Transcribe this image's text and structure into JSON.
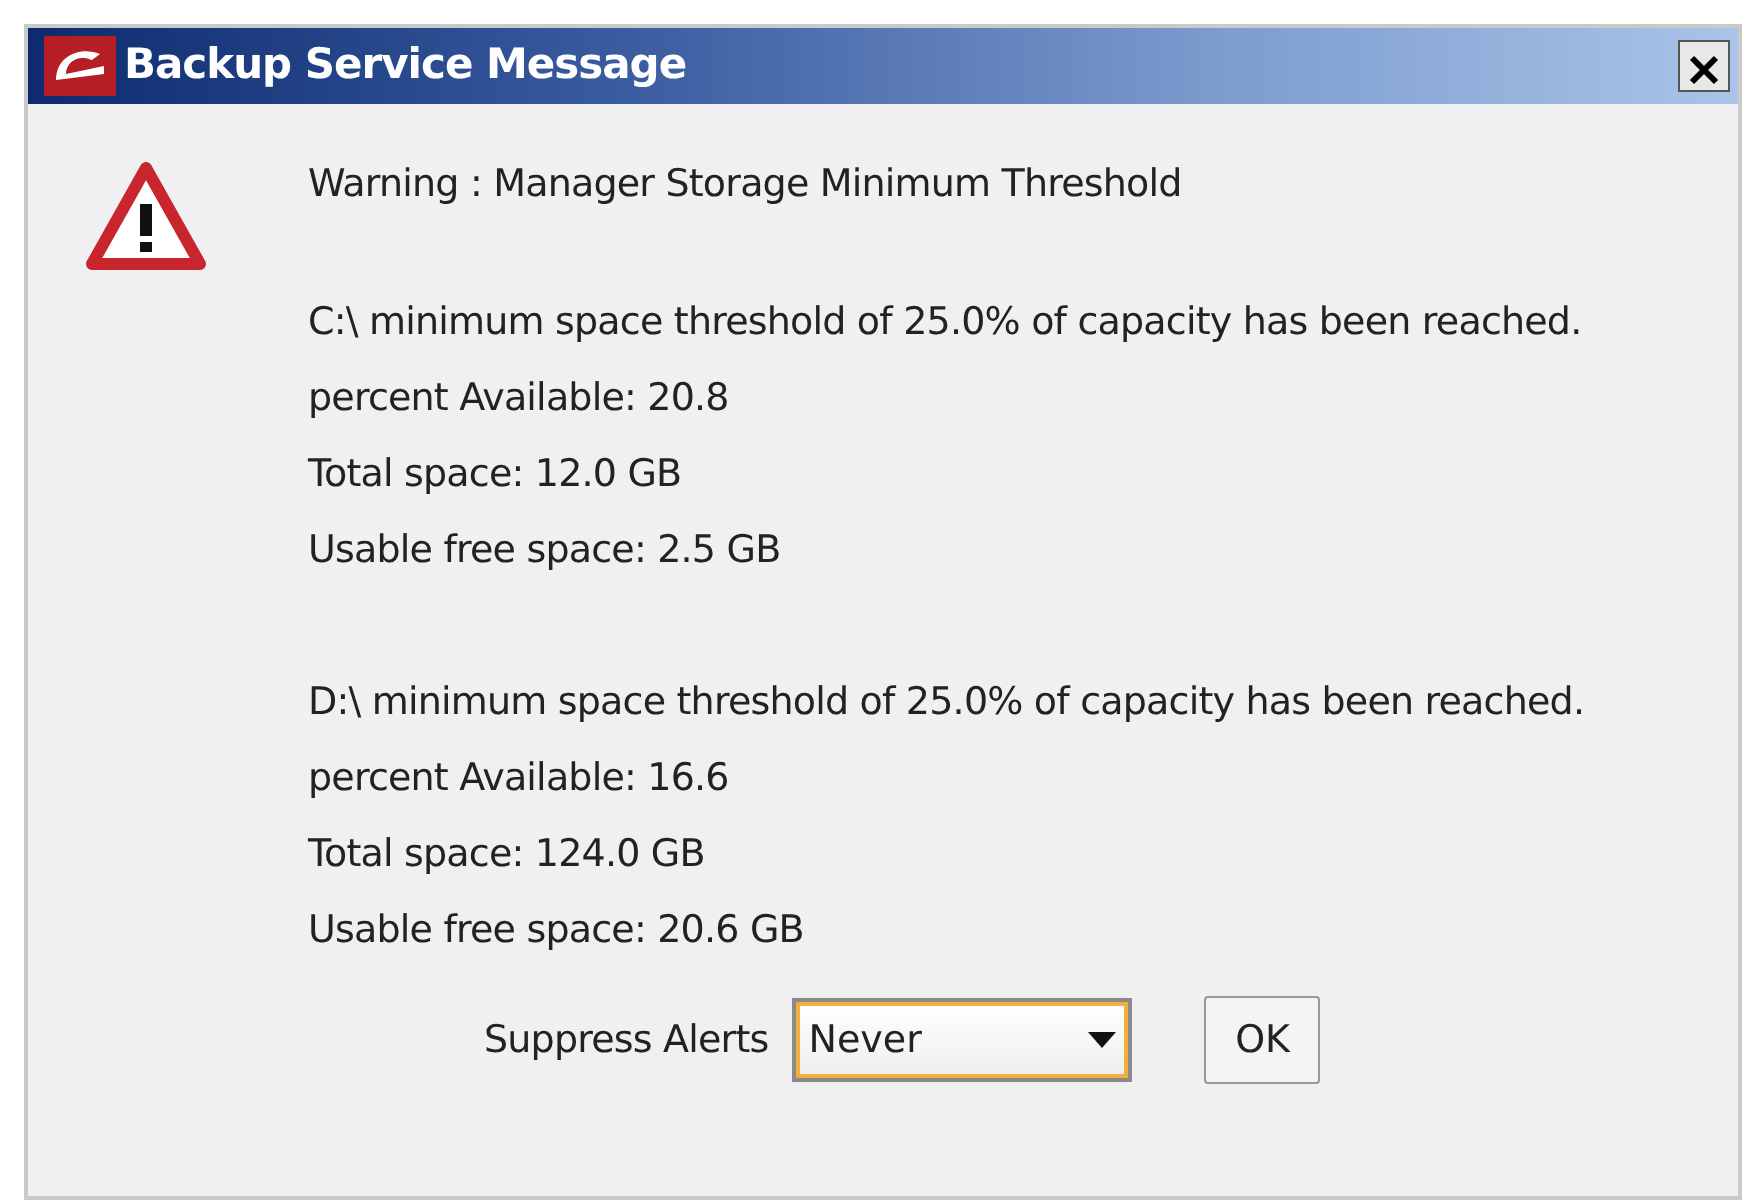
{
  "window": {
    "title": "Backup Service Message"
  },
  "message": {
    "heading": "Warning : Manager Storage Minimum Threshold",
    "sections": [
      {
        "lines": [
          "C:\\ minimum space threshold of 25.0% of capacity has been reached.",
          "percent Available: 20.8",
          "Total space: 12.0 GB",
          "Usable free space: 2.5 GB"
        ]
      },
      {
        "lines": [
          "D:\\ minimum space threshold of 25.0% of capacity has been reached.",
          "percent Available: 16.6",
          "Total space: 124.0 GB",
          "Usable free space: 20.6 GB"
        ]
      }
    ]
  },
  "suppress": {
    "label": "Suppress Alerts",
    "value": "Never",
    "focused": true
  },
  "buttons": [
    "OK"
  ]
}
